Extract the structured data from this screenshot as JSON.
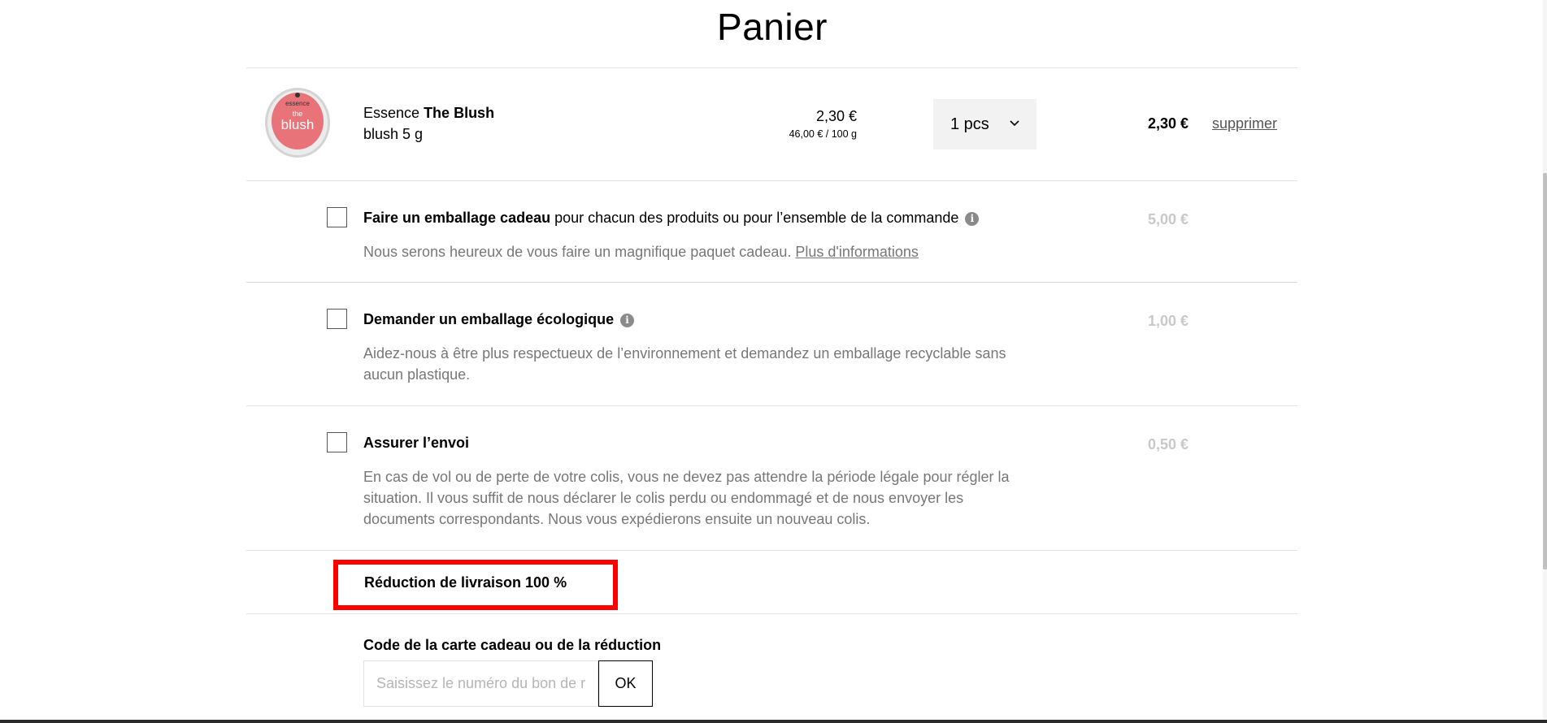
{
  "page": {
    "title": "Panier"
  },
  "product": {
    "brand": "Essence",
    "name": "The Blush",
    "description": "blush 5 g",
    "image_text_top": "essence",
    "image_text_mid": "the",
    "image_text_main": "blush",
    "unit_price": "2,30 €",
    "unit_ref": "46,00 € / 100 g",
    "quantity": "1 pcs",
    "total": "2,30 €",
    "remove_label": "supprimer"
  },
  "options": {
    "gift": {
      "title_bold": "Faire un emballage cadeau",
      "title_rest": " pour chacun des produits ou pour l’ensemble de la commande",
      "desc": "Nous serons heureux de vous faire un magnifique paquet cadeau.",
      "link": "Plus d'informations",
      "price": "5,00 €"
    },
    "eco": {
      "title": "Demander un emballage écologique",
      "desc": "Aidez-nous à être plus respectueux de l’environnement et demandez un emballage recyclable sans aucun plastique.",
      "price": "1,00 €"
    },
    "insurance": {
      "title": "Assurer l’envoi",
      "desc": "En cas de vol ou de perte de votre colis, vous ne devez pas attendre la période légale pour régler la situation. Il vous suffit de nous déclarer le colis perdu ou endommagé et de nous envoyer les documents correspondants. Nous vous expédierons ensuite un nouveau colis.",
      "price": "0,50 €"
    }
  },
  "promo": {
    "text": "Réduction de livraison 100 %"
  },
  "voucher": {
    "label": "Code de la carte cadeau ou de la réduction",
    "placeholder": "Saisissez le numéro du bon de réduction",
    "button": "OK"
  },
  "icons": {
    "info": "info-icon",
    "chevron": "chevron-down-icon"
  },
  "colors": {
    "highlight": "#ff0000",
    "muted_price": "#c8c8c8",
    "blush": "#e87378"
  }
}
